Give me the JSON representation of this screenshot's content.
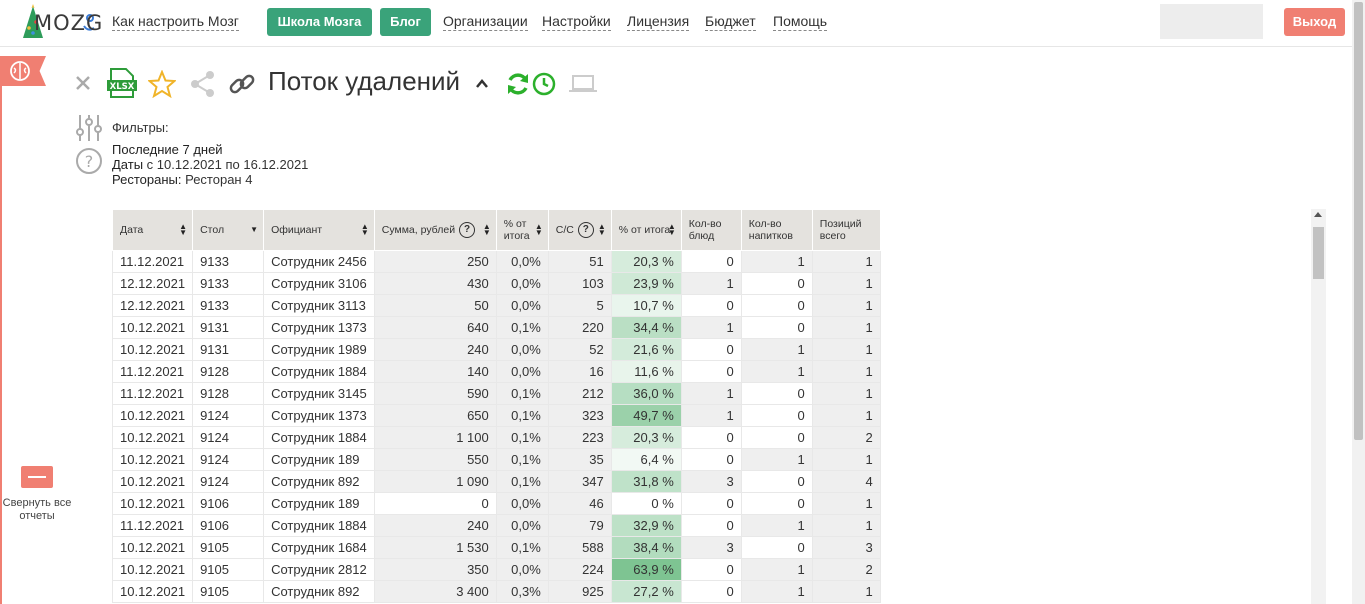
{
  "nav": {
    "logo_text": "MOZG",
    "how_to": "Как настроить Мозг",
    "school": "Школа Мозга",
    "blog": "Блог",
    "links": [
      "Организации",
      "Настройки",
      "Лицензия",
      "Бюджет",
      "Помощь"
    ],
    "logout": "Выход"
  },
  "sidebar": {
    "collapse_label": "Свернуть все отчеты"
  },
  "toolbar": {
    "title": "Поток удалений",
    "xlsx_label": "XLSX"
  },
  "filters": {
    "label": "Фильтры:",
    "period": "Последние 7 дней",
    "dates_key": "Даты",
    "dates_value": "с 10.12.2021 по 16.12.2021",
    "restaurants_key": "Рестораны:",
    "restaurants_value": "Ресторан 4"
  },
  "colors": {
    "accent_green": "#3aa37a",
    "logout_red": "#f07f72",
    "refresh_green": "#2cb02c"
  },
  "table": {
    "columns": [
      {
        "label": "Дата"
      },
      {
        "label": "Стол"
      },
      {
        "label": "Официант"
      },
      {
        "label": "Сумма, рублей"
      },
      {
        "label": "% от итога"
      },
      {
        "label": "С/С"
      },
      {
        "label": "% от итога"
      },
      {
        "label": "Кол-во блюд"
      },
      {
        "label": "Кол-во напитков"
      },
      {
        "label": "Позиций всего"
      }
    ],
    "rows": [
      [
        "11.12.2021",
        "9133",
        "Сотрудник 2456",
        "250",
        "0,0%",
        "51",
        "20,3 %",
        "0",
        "1",
        "1"
      ],
      [
        "12.12.2021",
        "9133",
        "Сотрудник 3106",
        "430",
        "0,0%",
        "103",
        "23,9 %",
        "1",
        "0",
        "1"
      ],
      [
        "12.12.2021",
        "9133",
        "Сотрудник 3113",
        "50",
        "0,0%",
        "5",
        "10,7 %",
        "0",
        "0",
        "1"
      ],
      [
        "10.12.2021",
        "9131",
        "Сотрудник 1373",
        "640",
        "0,1%",
        "220",
        "34,4 %",
        "1",
        "0",
        "1"
      ],
      [
        "10.12.2021",
        "9131",
        "Сотрудник 1989",
        "240",
        "0,0%",
        "52",
        "21,6 %",
        "0",
        "1",
        "1"
      ],
      [
        "11.12.2021",
        "9128",
        "Сотрудник 1884",
        "140",
        "0,0%",
        "16",
        "11,6 %",
        "0",
        "1",
        "1"
      ],
      [
        "11.12.2021",
        "9128",
        "Сотрудник 3145",
        "590",
        "0,1%",
        "212",
        "36,0 %",
        "1",
        "0",
        "1"
      ],
      [
        "10.12.2021",
        "9124",
        "Сотрудник 1373",
        "650",
        "0,1%",
        "323",
        "49,7 %",
        "1",
        "0",
        "1"
      ],
      [
        "10.12.2021",
        "9124",
        "Сотрудник 1884",
        "1 100",
        "0,1%",
        "223",
        "20,3 %",
        "0",
        "0",
        "2"
      ],
      [
        "10.12.2021",
        "9124",
        "Сотрудник 189",
        "550",
        "0,1%",
        "35",
        "6,4 %",
        "0",
        "1",
        "1"
      ],
      [
        "10.12.2021",
        "9124",
        "Сотрудник 892",
        "1 090",
        "0,1%",
        "347",
        "31,8 %",
        "3",
        "0",
        "4"
      ],
      [
        "10.12.2021",
        "9106",
        "Сотрудник 189",
        "0",
        "0,0%",
        "46",
        "0 %",
        "0",
        "0",
        "1"
      ],
      [
        "11.12.2021",
        "9106",
        "Сотрудник 1884",
        "240",
        "0,0%",
        "79",
        "32,9 %",
        "0",
        "1",
        "1"
      ],
      [
        "10.12.2021",
        "9105",
        "Сотрудник 1684",
        "1 530",
        "0,1%",
        "588",
        "38,4 %",
        "3",
        "0",
        "3"
      ],
      [
        "10.12.2021",
        "9105",
        "Сотрудник 2812",
        "350",
        "0,0%",
        "224",
        "63,9 %",
        "0",
        "1",
        "2"
      ],
      [
        "10.12.2021",
        "9105",
        "Сотрудник 892",
        "3 400",
        "0,3%",
        "925",
        "27,2 %",
        "0",
        "1",
        "1"
      ]
    ]
  }
}
